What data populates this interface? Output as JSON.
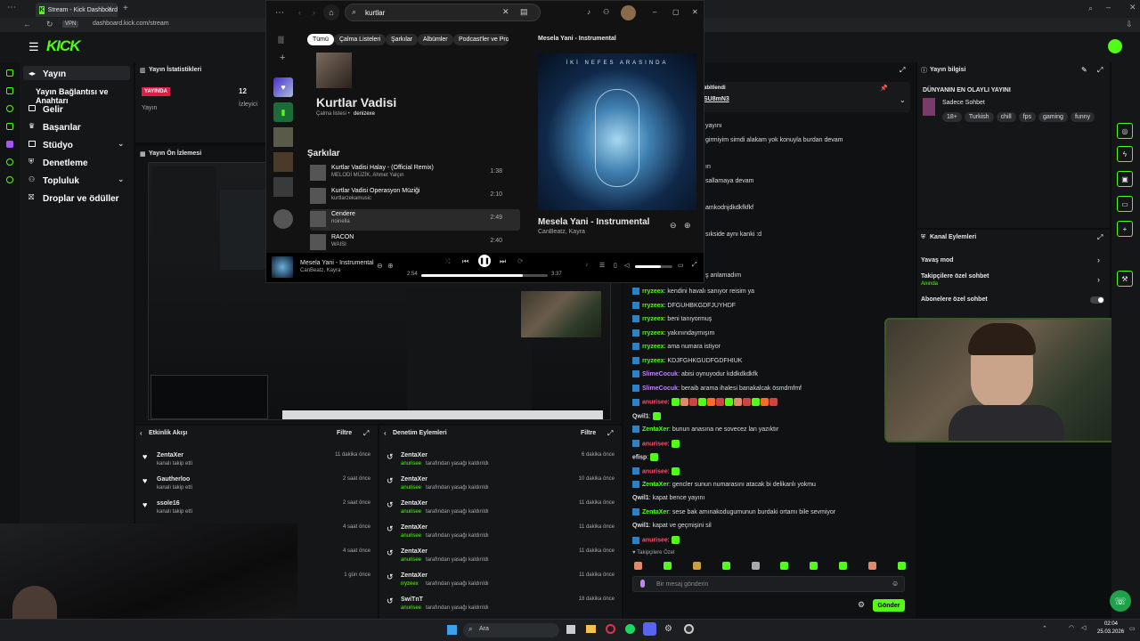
{
  "browser": {
    "tab_title": "Stream - Kick Dashboard",
    "address": "dashboard.kick.com/stream",
    "vpn_label": "VPN"
  },
  "kick": {
    "logo": "KICK",
    "sidebar": [
      {
        "label": "Yayın",
        "icon": "broadcast-icon"
      },
      {
        "label": "Yayın Bağlantısı ve Anahtarı",
        "icon": "key-icon"
      },
      {
        "label": "Gelir",
        "icon": "wallet-icon"
      },
      {
        "label": "Başarılar",
        "icon": "trophy-icon"
      },
      {
        "label": "Stüdyo",
        "icon": "studio-icon"
      },
      {
        "label": "Denetleme",
        "icon": "shield-icon"
      },
      {
        "label": "Topluluk",
        "icon": "people-icon"
      },
      {
        "label": "Droplar ve ödüller",
        "icon": "gift-icon"
      }
    ],
    "stats": {
      "title": "Yayın İstatistikleri",
      "live_badge": "YAYINDA",
      "status_label": "Yayın",
      "viewer_count": "12",
      "viewer_label": "İzleyici"
    },
    "preview": {
      "title": "Yayın Ön İzlemesi"
    },
    "activity": {
      "title": "Etkinlik Akışı",
      "filter": "Filtre",
      "rows": [
        {
          "user": "ZentaXer",
          "desc": "kanalı takip etti",
          "time": "11 dakika önce"
        },
        {
          "user": "Gautherloo",
          "desc": "kanalı takip etti",
          "time": "2 saat önce"
        },
        {
          "user": "ssole16",
          "desc": "kanalı takip etti",
          "time": "2 saat önce"
        },
        {
          "user": "",
          "desc": "",
          "time": "4 saat önce"
        },
        {
          "user": "",
          "desc": "",
          "time": "4 saat önce"
        },
        {
          "user": "",
          "desc": "",
          "time": "1 gün önce"
        }
      ]
    },
    "moderation": {
      "title": "Denetim Eylemleri",
      "filter": "Filtre",
      "rows": [
        {
          "user": "ZentaXer",
          "by": "anurisee",
          "desc": "tarafından yasağı kaldırıldı",
          "time": "6 dakika önce"
        },
        {
          "user": "ZentaXer",
          "by": "anurisee",
          "desc": "tarafından yasağı kaldırıldı",
          "time": "10 dakika önce"
        },
        {
          "user": "ZentaXer",
          "by": "anurisee",
          "desc": "tarafından yasağı kaldırıldı",
          "time": "11 dakika önce"
        },
        {
          "user": "ZentaXer",
          "by": "anurisee",
          "desc": "tarafından yasağı kaldırıldı",
          "time": "11 dakika önce"
        },
        {
          "user": "ZentaXer",
          "by": "anurisee",
          "desc": "tarafından yasağı kaldırıldı",
          "time": "11 dakika önce"
        },
        {
          "user": "ZentaXer",
          "by": "rryzeex",
          "desc": "tarafından yasağı kaldırıldı",
          "time": "11 dakika önce"
        },
        {
          "user": "SwiTnT",
          "by": "anurisee",
          "desc": "tarafından yasağı kaldırıldı",
          "time": "18 dakika önce"
        }
      ]
    },
    "chat": {
      "pinned_label": "abitlendi",
      "pinned_user": "SU8mN3",
      "partial_lines": [
        "yayını",
        "girmiyim simdi alakam yok konuyla burdan devam",
        "ın",
        "sallamaya devam",
        "amkodnjdkdkfkfkf",
        "sıkside aynı kanki :d",
        "ş anlamadım"
      ],
      "messages": [
        {
          "user": "rryzeex",
          "color": "#53fc18",
          "text": "kendini havalı sanıyor reisim ya"
        },
        {
          "user": "rryzeex",
          "color": "#53fc18",
          "text": "DFGUHBKGDFJUYHDF"
        },
        {
          "user": "rryzeex",
          "color": "#53fc18",
          "text": "beni tanıyormuş"
        },
        {
          "user": "rryzeex",
          "color": "#53fc18",
          "text": "yakınındaymışım"
        },
        {
          "user": "rryzeex",
          "color": "#53fc18",
          "text": "ama numara istiyor"
        },
        {
          "user": "rryzeex",
          "color": "#53fc18",
          "text": "KDJFGHKGUDFGDFHIUK"
        },
        {
          "user": "SlimeCocuk",
          "color": "#c084fc",
          "text": "abisi oynuyodur kddkdkdkfk"
        },
        {
          "user": "SlimeCocuk",
          "color": "#c084fc",
          "text": "beraib arama ihalesi banakalcak ösmdmfmf"
        },
        {
          "user": "anurisee",
          "color": "#ff4d6d",
          "text": ""
        },
        {
          "user": "Qwil1",
          "color": "#dddddd",
          "text": ""
        },
        {
          "user": "ZentaXer",
          "color": "#53fc18",
          "text": "bunun anasına ne sovecez lan yazıktır"
        },
        {
          "user": "anurisee",
          "color": "#ff4d6d",
          "text": ""
        },
        {
          "user": "efisp",
          "color": "#dddddd",
          "text": ""
        },
        {
          "user": "anurisee",
          "color": "#ff4d6d",
          "text": ""
        },
        {
          "user": "ZentaXer",
          "color": "#53fc18",
          "text": "gencler sunun numarasını atacak bi delikanlı yokmu"
        },
        {
          "user": "Qwil1",
          "color": "#dddddd",
          "text": "kapat bence yayını"
        },
        {
          "user": "ZentaXer",
          "color": "#53fc18",
          "text": "sese bak amınakodugumunun burdaki ortamı bile sevmiyor"
        },
        {
          "user": "Qwil1",
          "color": "#dddddd",
          "text": "kapat ve geçmişini sil"
        },
        {
          "user": "anurisee",
          "color": "#ff4d6d",
          "text": ""
        }
      ],
      "followers_only_label": "Takipçilere Özel",
      "input_placeholder": "Bir mesaj gönderin",
      "send_label": "Gönder"
    },
    "stream_info": {
      "title": "Yayın bilgisi",
      "stream_title": "DÜNYANIN EN OLAYLI YAYINI",
      "category": "Sadece Sohbet",
      "tags": [
        "18+",
        "Turkish",
        "chill",
        "fps",
        "gaming",
        "funny"
      ]
    },
    "channel_actions": {
      "title": "Kanal Eylemleri",
      "items": [
        {
          "label": "Yavaş mod",
          "sub": ""
        },
        {
          "label": "Takipçilere özel sohbet",
          "sub": "Anında"
        },
        {
          "label": "Abonelere özel sohbet",
          "sub": ""
        }
      ]
    }
  },
  "spotify": {
    "search_value": "kurtlar",
    "filters": [
      "Tümü",
      "Çalma Listeleri",
      "Şarkılar",
      "Albümler",
      "Podcast'ler ve Prog"
    ],
    "playlist": {
      "title": "Kurtlar Vadisi",
      "meta_prefix": "Çalma listesi •",
      "owner": "denizexe"
    },
    "songs_heading": "Şarkılar",
    "songs": [
      {
        "title": "Kurtlar Vadisi Halay - (Official Remix)",
        "artist": "MELODİ MÜZİK, Ahmet Yalçın",
        "duration": "1:38"
      },
      {
        "title": "Kurtlar Vadisi Operasyon Müziği",
        "artist": "kurtlarzekamusic",
        "duration": "2:10"
      },
      {
        "title": "Cendere",
        "artist": "noinella",
        "duration": "2:49"
      },
      {
        "title": "RACON",
        "artist": "WAISI",
        "duration": "2:40"
      }
    ],
    "now_playing": {
      "panel_title": "Mesela Yani - Instrumental",
      "album_text": "İKİ NEFES ARASINDA",
      "title": "Mesela Yani - Instrumental",
      "artist": "CanBeatz, Kayra",
      "elapsed": "2:54",
      "total": "3:37",
      "progress": 0.8,
      "volume": 0.7
    }
  },
  "taskbar": {
    "search_label": "Ara",
    "clock_time": "02:04",
    "clock_date": "25.03.2026"
  }
}
